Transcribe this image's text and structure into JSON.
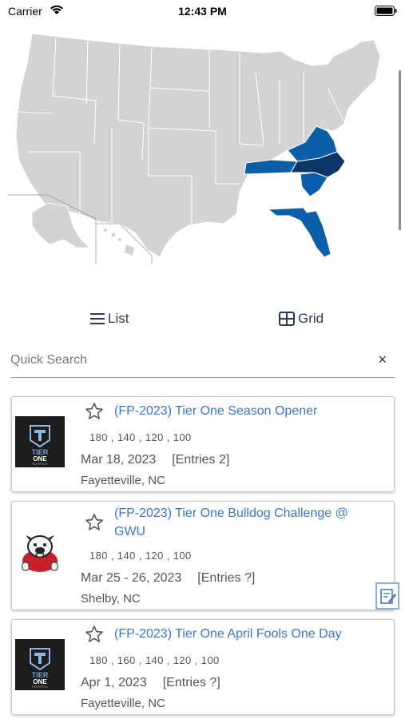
{
  "status_bar": {
    "carrier": "Carrier",
    "time": "12:43 PM"
  },
  "map": {
    "highlight_light": "#0b5fa8",
    "highlight_dark": "#0a3766",
    "base_color": "#d3d3d3",
    "highlighted_states": [
      "Virginia",
      "Tennessee",
      "South Carolina",
      "Florida"
    ],
    "selected_state": "North Carolina"
  },
  "view_toggle": {
    "list_label": "List",
    "grid_label": "Grid"
  },
  "search": {
    "placeholder": "Quick Search",
    "clear_icon": "×"
  },
  "events": [
    {
      "title": "(FP-2023) Tier One Season Opener",
      "classes": "180 , 140 , 120 , 100",
      "date": "Mar 18, 2023",
      "entries": "[Entries 2]",
      "location": "Fayetteville, NC",
      "logo": "tier-one-logo"
    },
    {
      "title": "(FP-2023) Tier One Bulldog Challenge @ GWU",
      "classes": "180 , 140 , 120 , 100",
      "date": "Mar 25 - 26, 2023",
      "entries": "[Entries ?]",
      "location": "Shelby, NC",
      "logo": "bulldog-logo"
    },
    {
      "title": "(FP-2023) Tier One April Fools One Day",
      "classes": "180 , 160 , 140 , 120 , 100",
      "date": "Apr 1, 2023",
      "entries": "[Entries ?]",
      "location": "Fayetteville, NC",
      "logo": "tier-one-logo"
    }
  ],
  "logo_text": {
    "tier": "TIER",
    "one": "ONE",
    "sub": "FASTPITCH"
  }
}
